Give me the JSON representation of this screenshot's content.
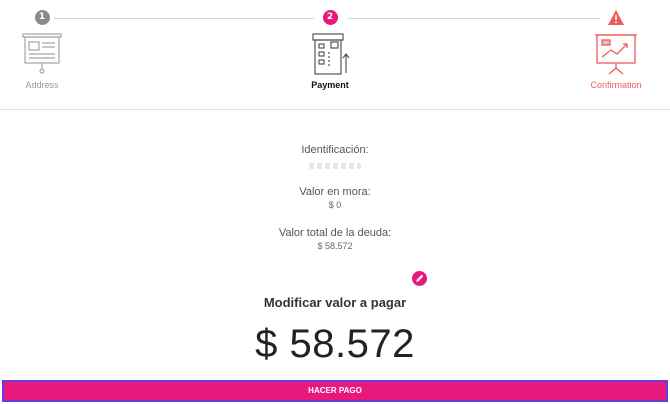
{
  "stepper": {
    "steps": [
      {
        "number": "1",
        "label": "Address",
        "state": "completed",
        "icon": "presentation-board-icon"
      },
      {
        "number": "2",
        "label": "Payment",
        "state": "active",
        "icon": "card-payment-icon"
      },
      {
        "number": "",
        "label": "Confirmation",
        "state": "warning",
        "icon": "chart-presentation-icon"
      }
    ]
  },
  "debt_info": {
    "id_label": "Identificación:",
    "mora_label": "Valor en mora:",
    "mora_value": "$ 0",
    "total_label": "Valor total de la deuda:",
    "total_value": "$ 58.572"
  },
  "payment": {
    "modify_title": "Modificar valor a pagar",
    "amount": "$ 58.572",
    "pay_button": "HACER PAGO"
  },
  "colors": {
    "accent": "#e8197d",
    "warning": "#ef5a5a",
    "completed": "#8b8b8b",
    "focus_outline": "#6a3bdb"
  }
}
